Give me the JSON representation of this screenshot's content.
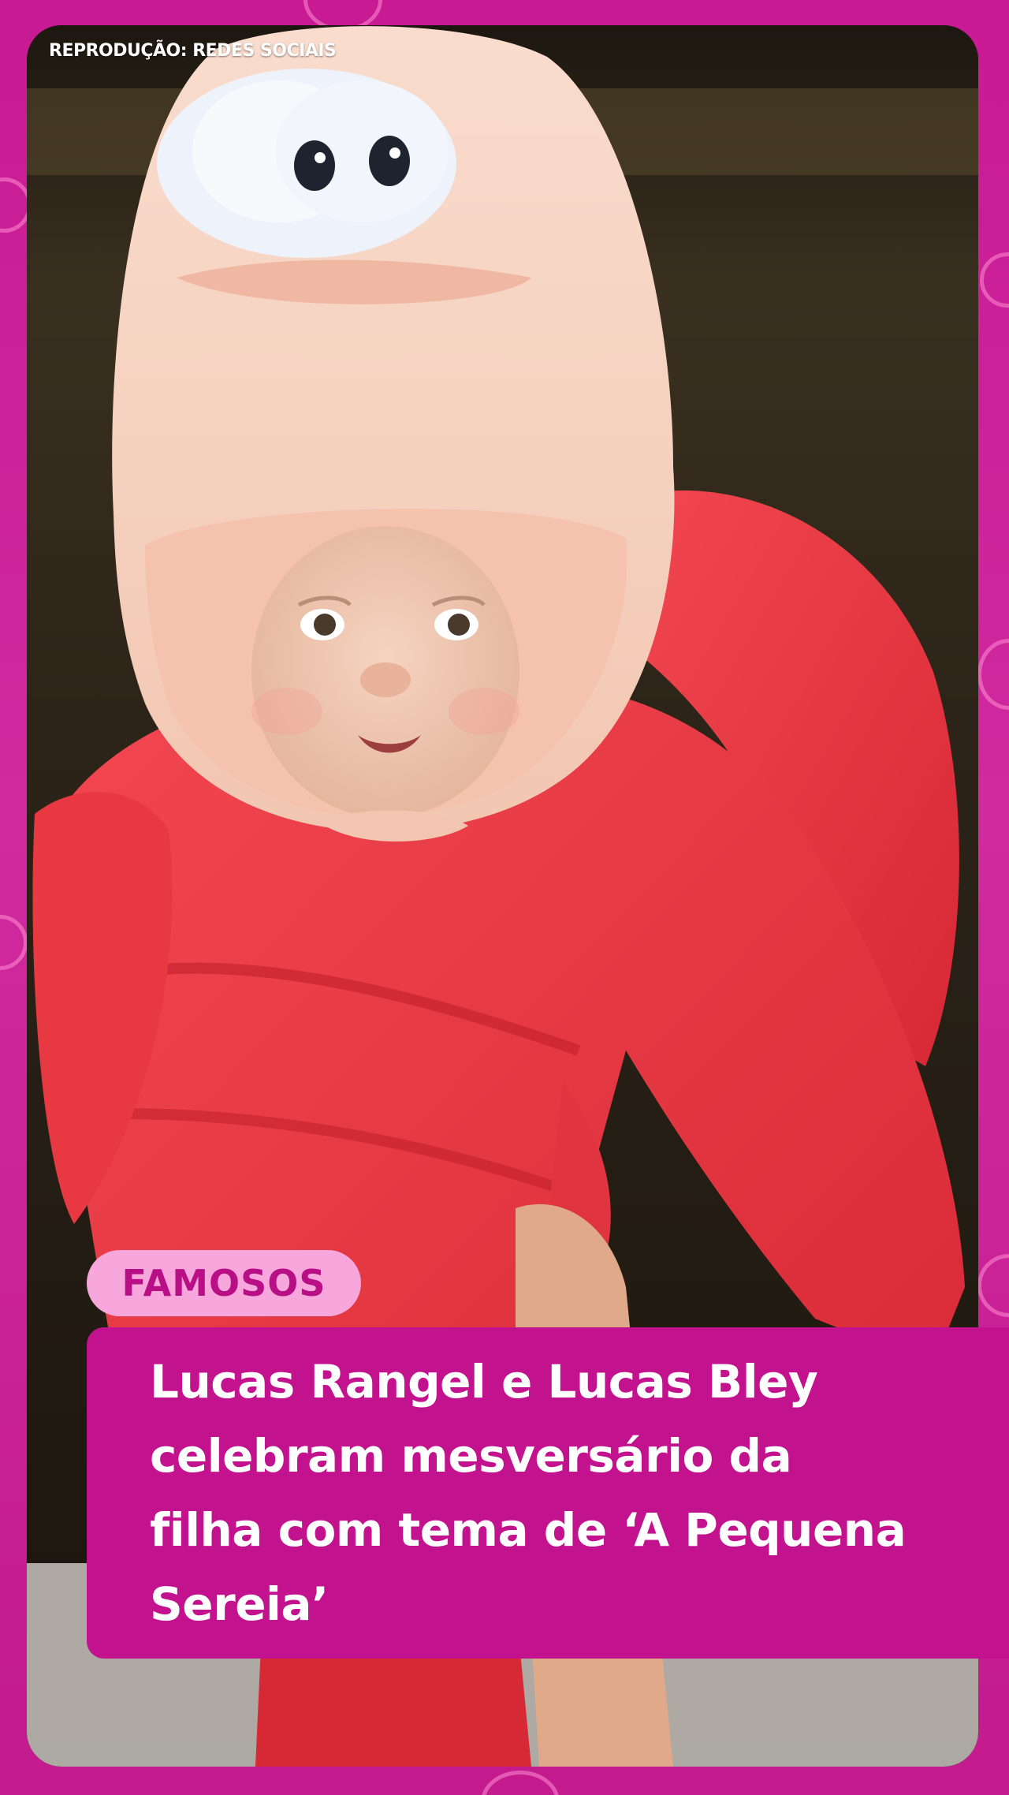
{
  "credit": "REPRODUÇÃO: REDES SOCIAIS",
  "category_tag": "FAMOSOS",
  "headline_lines": [
    "Lucas Rangel e Lucas Bley",
    "celebram mesversário da",
    "filha com tema de ‘A Pequena",
    "Sereia’"
  ],
  "colors": {
    "frame": "#c81a93",
    "headline_bg": "#c3128d",
    "tag_bg": "#f7a7dc",
    "tag_text": "#b80f86",
    "costume_red": "#e8323f",
    "hood_pink": "#f7d4c4"
  }
}
